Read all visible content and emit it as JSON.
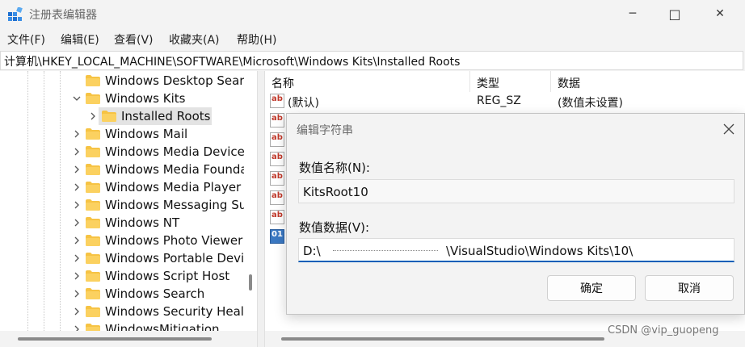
{
  "window": {
    "title": "注册表编辑器",
    "minimize": "─",
    "maximize": "□",
    "close": "✕"
  },
  "menu": [
    "文件(F)",
    "编辑(E)",
    "查看(V)",
    "收藏夹(A)",
    "帮助(H)"
  ],
  "address": "计算机\\HKEY_LOCAL_MACHINE\\SOFTWARE\\Microsoft\\Windows Kits\\Installed Roots",
  "tree": [
    {
      "label": "Windows Desktop Search",
      "expander": "none"
    },
    {
      "label": "Windows Kits",
      "expander": "expanded"
    },
    {
      "label": "Installed Roots",
      "expander": "collapsed",
      "selected": true,
      "child": true
    },
    {
      "label": "Windows Mail",
      "expander": "collapsed"
    },
    {
      "label": "Windows Media Device Manager",
      "expander": "collapsed"
    },
    {
      "label": "Windows Media Foundation",
      "expander": "collapsed"
    },
    {
      "label": "Windows Media Player NSS",
      "expander": "collapsed"
    },
    {
      "label": "Windows Messaging Subsystem",
      "expander": "collapsed"
    },
    {
      "label": "Windows NT",
      "expander": "collapsed"
    },
    {
      "label": "Windows Photo Viewer",
      "expander": "collapsed"
    },
    {
      "label": "Windows Portable Devices",
      "expander": "collapsed"
    },
    {
      "label": "Windows Script Host",
      "expander": "collapsed"
    },
    {
      "label": "Windows Search",
      "expander": "collapsed"
    },
    {
      "label": "Windows Security Health",
      "expander": "collapsed"
    },
    {
      "label": "WindowsMitigation",
      "expander": "collapsed"
    }
  ],
  "columns": {
    "name": "名称",
    "type": "类型",
    "data": "数据"
  },
  "values": [
    {
      "name": "(默认)",
      "type": "REG_SZ",
      "data": "(数值未设置)",
      "icon": "string-value-icon"
    },
    {
      "icon": "string-value-icon"
    },
    {
      "icon": "string-value-icon"
    },
    {
      "icon": "string-value-icon"
    },
    {
      "icon": "string-value-icon"
    },
    {
      "icon": "string-value-icon"
    },
    {
      "icon": "string-value-icon"
    },
    {
      "icon": "binary-value-icon"
    }
  ],
  "dialog": {
    "title": "编辑字符串",
    "name_label": "数值名称(N):",
    "name_value": "KitsRoot10",
    "data_label": "数值数据(V):",
    "data_prefix": "D:\\",
    "data_suffix": "\\VisualStudio\\Windows Kits\\10\\",
    "ok": "确定",
    "cancel": "取消"
  },
  "watermark": "CSDN @vip_guopeng",
  "colors": {
    "accent": "#005fb8",
    "folder": "#f6c344",
    "selection": "#e3e3e3"
  }
}
